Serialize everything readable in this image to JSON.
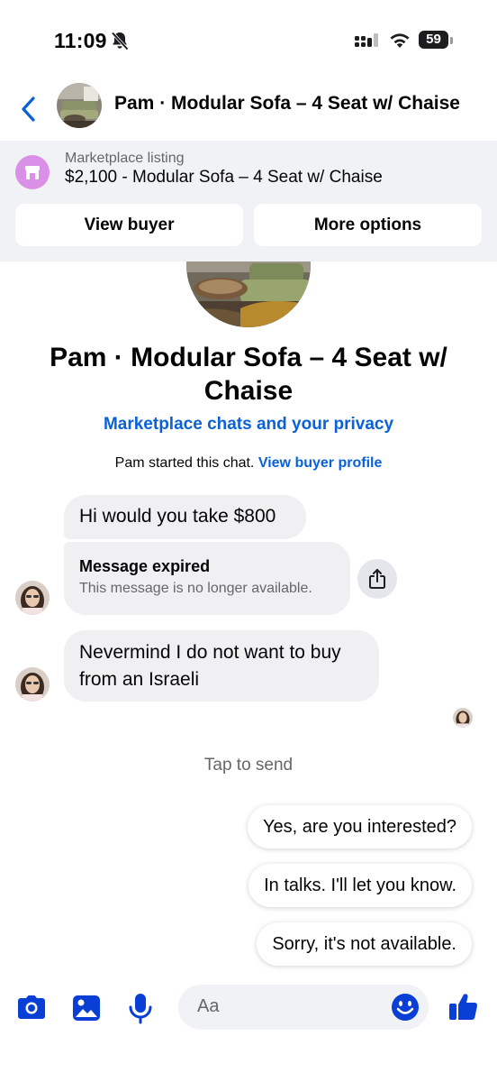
{
  "status_bar": {
    "time": "11:09",
    "battery": "59",
    "battery_level": 0.59,
    "icons": [
      "bell-muted-icon",
      "signal-icon",
      "wifi-icon",
      "battery-icon"
    ]
  },
  "header": {
    "title": "Pam · Modular Sofa – 4 Seat w/ Chaise",
    "back_icon": "chevron-left-icon"
  },
  "listing": {
    "label": "Marketplace listing",
    "title": "$2,100 - Modular Sofa – 4 Seat w/ Chaise",
    "view_buyer_label": "View buyer",
    "more_options_label": "More options"
  },
  "intro": {
    "name": "Pam · Modular Sofa – 4 Seat w/ Chaise",
    "privacy_link": "Marketplace chats and your privacy",
    "started_text": "Pam started this chat.",
    "buyer_profile_link": "View buyer profile"
  },
  "messages": [
    {
      "text": "Hi would you take $800"
    },
    {
      "title": "Message expired",
      "subtitle": "This message is no longer available."
    },
    {
      "text": "Nevermind I do not want to buy from an Israeli"
    }
  ],
  "tap_to_send": "Tap to send",
  "quick_replies": [
    "Yes, are you interested?",
    "In talks. I'll let you know.",
    "Sorry, it's not available."
  ],
  "composer": {
    "placeholder": "Aa",
    "icons": [
      "camera-icon",
      "gallery-icon",
      "microphone-icon",
      "emoji-icon",
      "thumbs-up-icon"
    ]
  },
  "colors": {
    "accent": "#0a61d6",
    "composer_icon": "#0a3fd6",
    "bubble": "#f0f0f2",
    "banner": "#f0f2f5",
    "shop_icon_bg": "#d990e6"
  }
}
